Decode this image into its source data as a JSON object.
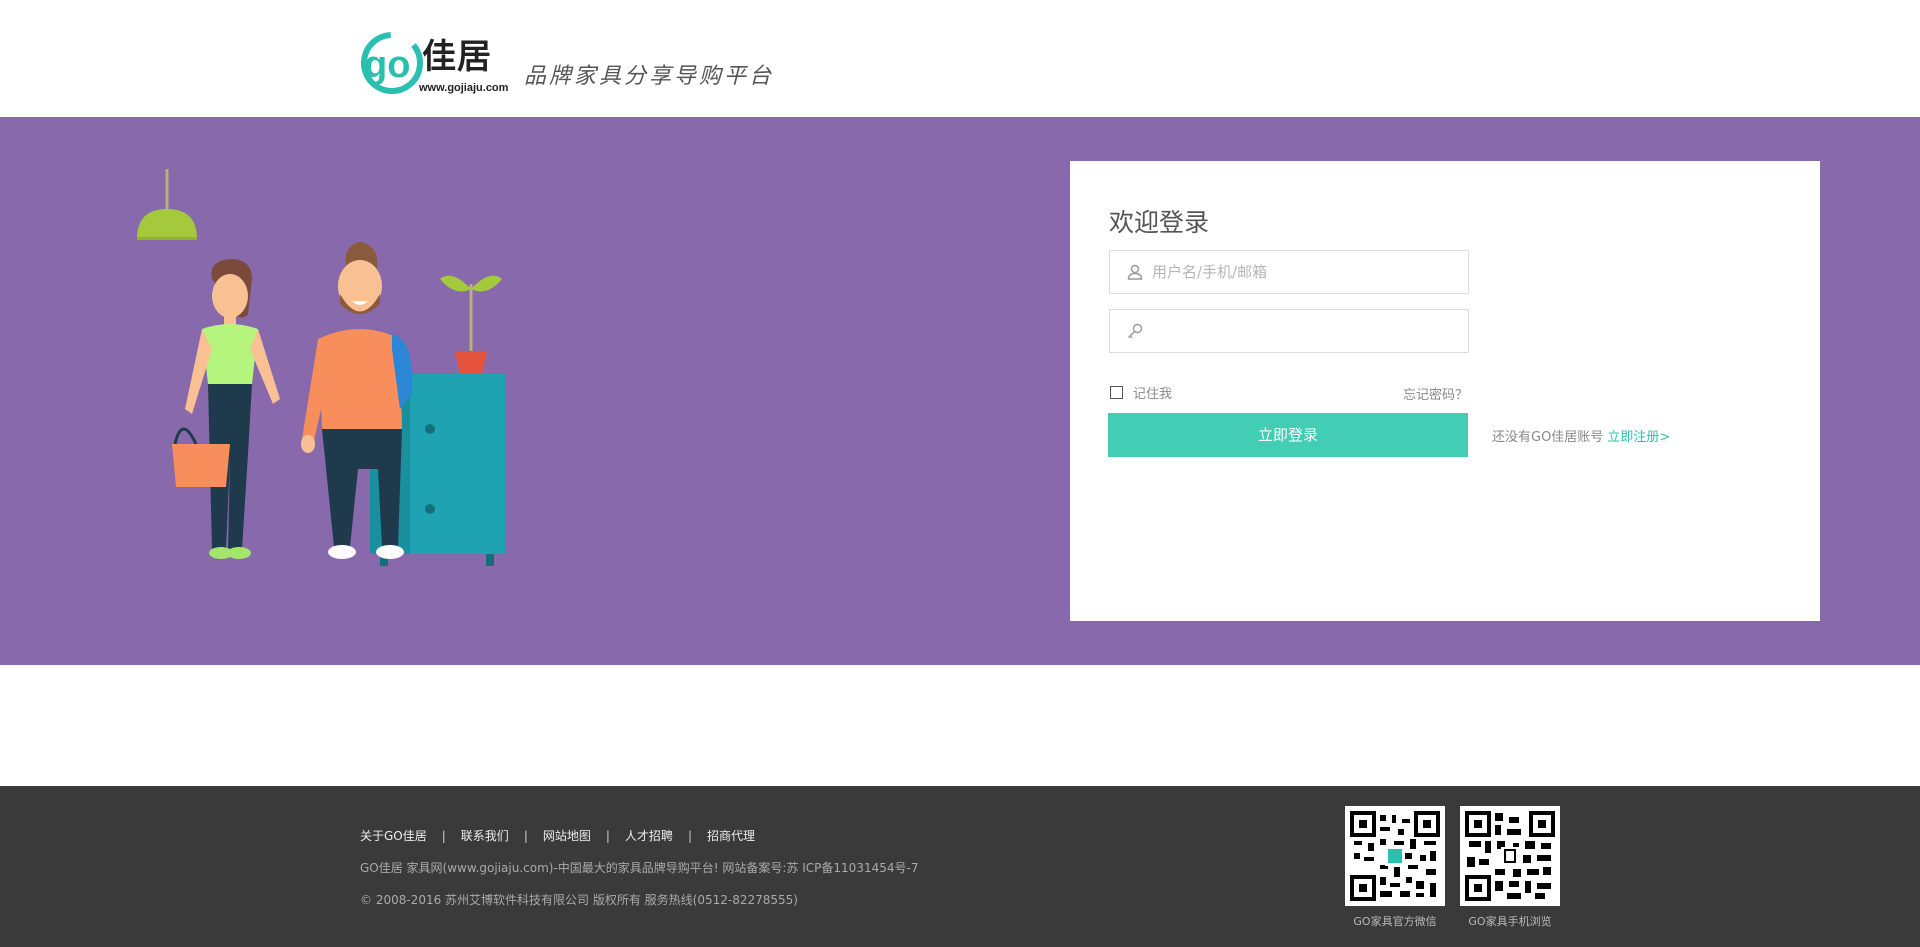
{
  "header": {
    "logo_text": "佳居",
    "logo_url": "www.gojiaju.com",
    "slogan": "品牌家具分享导购平台"
  },
  "login": {
    "title": "欢迎登录",
    "username_placeholder": "用户名/手机/邮箱",
    "password_value": "",
    "remember_label": "记住我",
    "forgot_label": "忘记密码？",
    "submit_label": "立即登录",
    "no_account_text": "还没有GO佳居账号",
    "register_label": "立即注册>"
  },
  "colors": {
    "banner": "#8869ab",
    "accent": "#43cdb5",
    "footer": "#3a3a3a"
  },
  "footer": {
    "links": [
      "关于GO佳居",
      "联系我们",
      "网站地图",
      "人才招聘",
      "招商代理"
    ],
    "separator": "|",
    "line1": "GO佳居 家具网(www.gojiaju.com)-中国最大的家具品牌导购平台! 网站备案号:苏 ICP备11031454号-7",
    "line2": "© 2008-2016 苏州艾博软件科技有限公司 版权所有 服务热线(0512-82278555)",
    "qr_wechat_caption": "GO家具官方微信",
    "qr_mobile_caption": "GO家具手机浏览"
  }
}
